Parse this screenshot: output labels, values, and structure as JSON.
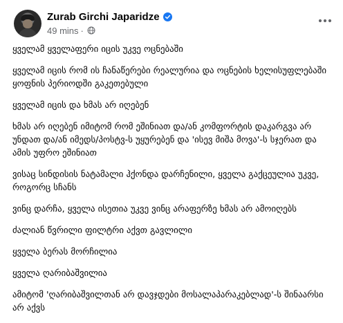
{
  "post": {
    "author": "Zurab Girchi Japaridze",
    "timestamp": "49 mins",
    "separator": "·",
    "paragraphs": [
      "ყველამ ყველაფერი იცის უკვე ოცნებაში",
      "ყველამ იცის რომ ის ჩანაწერები რეალურია და ოცნების ხელისუფლებაში ყოფნის პერიოდში გაკეთებული",
      "ყველამ იცის და ხმას არ იღებენ",
      "ხმას არ იღებენ იმიტომ რომ ეშინიათ და/ან კომფორტის დაკარგვა არ უნდათ და/ან იმედს/პოსტვ-ს უყურებენ და 'ისევ მიშა მოვა'-ს სჯერათ და ამის უფრო ეშინიათ",
      "ვისაც სინდისის ნატამალი ჰქონდა დარჩენილი, ყველა გაქცეულია უკვე, როგორც სჩანს",
      "ვინც დარჩა, ყველა ისეთია უკვე ვინც არაფერზე ხმას არ ამოიღებს",
      "ძალიან წვრილი ფილტრი აქვთ გავლილი",
      "ყველა ბერას მორჩილია",
      "ყველა ღარიბაშვილია",
      "ამიტომ 'ღარიბაშვილთან არ დავჯდები მოსალაპარაკებლად'-ს შინაარსი არ აქვს"
    ]
  },
  "icons": {
    "verified": "verified-badge-icon",
    "audience": "globe-icon",
    "more": "more-options-icon"
  },
  "colors": {
    "verified": "#1877f2",
    "meta_text": "#65676b",
    "body_text": "#050505"
  }
}
